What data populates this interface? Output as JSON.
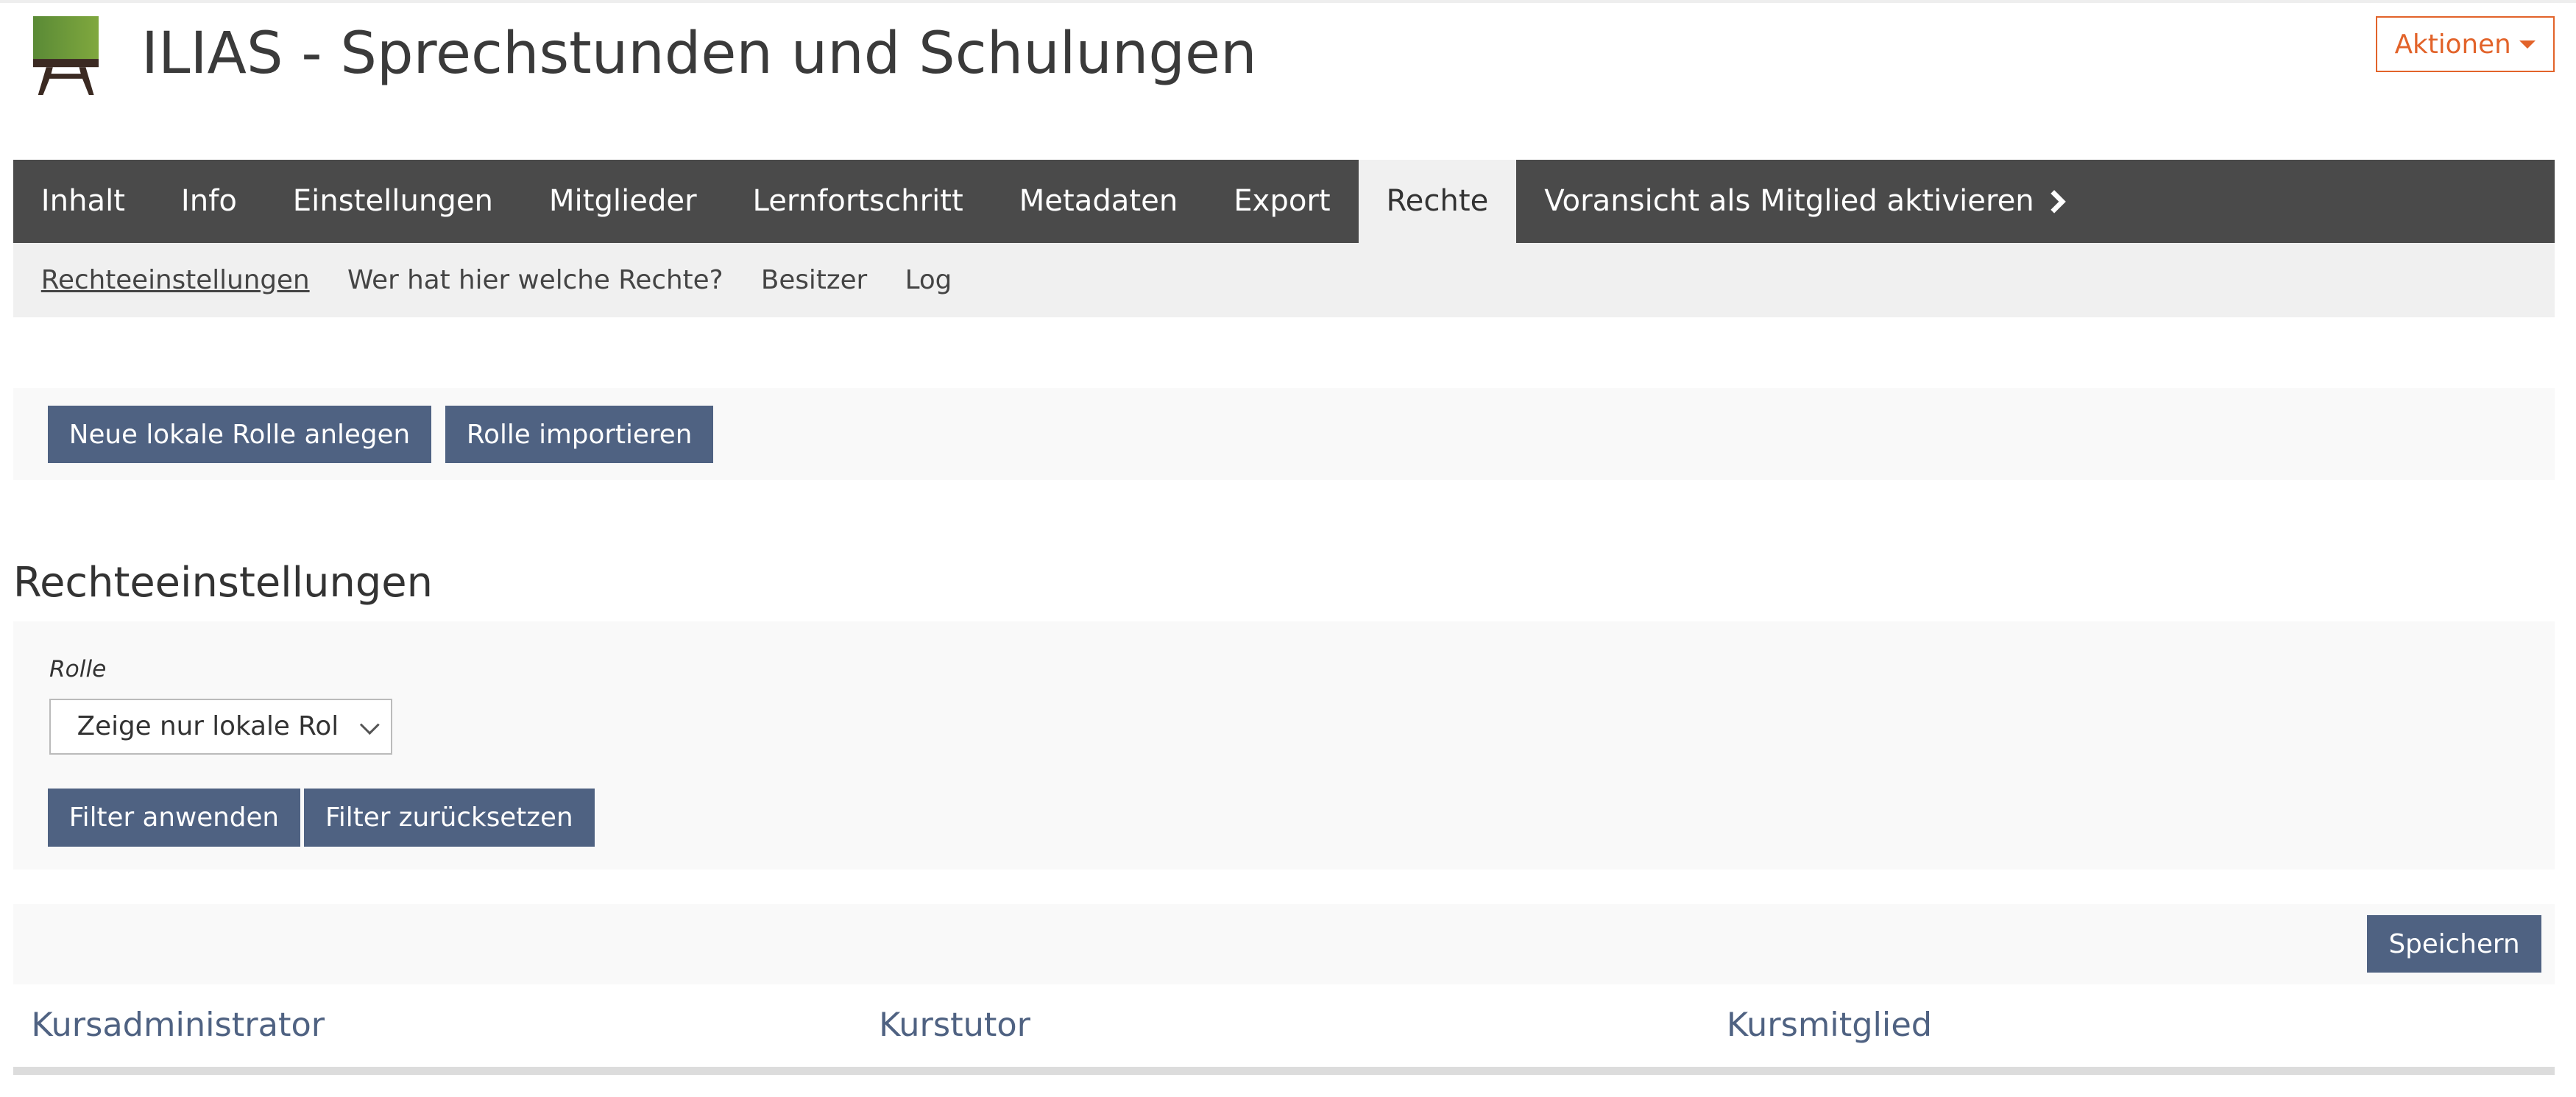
{
  "header": {
    "title": "ILIAS - Sprechstunden und Schulungen",
    "icon": "course-board-icon",
    "actions_label": "Aktionen"
  },
  "tabs": [
    {
      "label": "Inhalt"
    },
    {
      "label": "Info"
    },
    {
      "label": "Einstellungen"
    },
    {
      "label": "Mitglieder"
    },
    {
      "label": "Lernfortschritt"
    },
    {
      "label": "Metadaten"
    },
    {
      "label": "Export"
    },
    {
      "label": "Rechte",
      "active": true
    },
    {
      "label": "Voransicht als Mitglied aktivieren"
    }
  ],
  "subtabs": [
    {
      "label": "Rechteeinstellungen",
      "active": true
    },
    {
      "label": "Wer hat hier welche Rechte?"
    },
    {
      "label": "Besitzer"
    },
    {
      "label": "Log"
    }
  ],
  "toolbar": {
    "new_role": "Neue lokale Rolle anlegen",
    "import_role": "Rolle importieren"
  },
  "section_title": "Rechteeinstellungen",
  "filter": {
    "role_label": "Rolle",
    "role_value": "Zeige nur lokale Rol",
    "apply": "Filter anwenden",
    "reset": "Filter zurücksetzen"
  },
  "table": {
    "save": "Speichern",
    "columns": [
      "Kursadministrator",
      "Kurstutor",
      "Kursmitglied"
    ]
  },
  "colors": {
    "accent": "#4f6282",
    "action": "#e2632a",
    "tabbar": "#4a4a4a"
  }
}
